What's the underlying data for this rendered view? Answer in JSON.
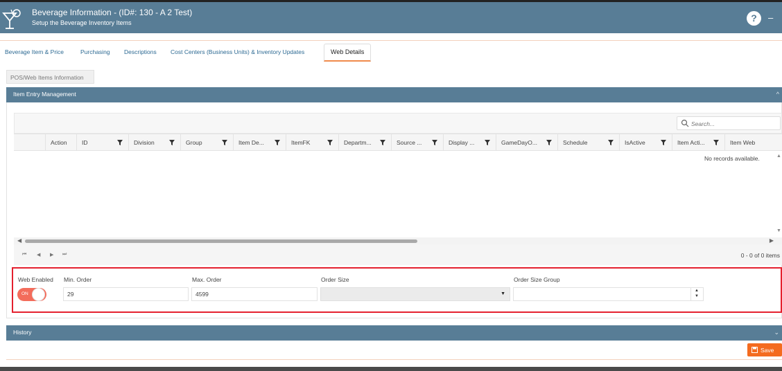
{
  "header": {
    "title": "Beverage Information - (ID#: 130 - A 2 Test)",
    "subtitle": "Setup the Beverage Inventory Items",
    "help_label": "?",
    "minimize_label": "–",
    "colors": {
      "header_bg": "#587d96",
      "accent": "#f46b1f"
    }
  },
  "tabs": [
    {
      "label": "Beverage Item & Price"
    },
    {
      "label": "Purchasing"
    },
    {
      "label": "Descriptions"
    },
    {
      "label": "Cost Centers (Business Units) & Inventory Updates"
    },
    {
      "label": "Web Details",
      "active": true
    }
  ],
  "subtab": {
    "label": "POS/Web Items Information"
  },
  "item_entry": {
    "title": "Item Entry Management",
    "search_placeholder": "Search...",
    "columns": [
      {
        "label": "Action",
        "filter": false
      },
      {
        "label": "ID",
        "filter": true
      },
      {
        "label": "Division",
        "filter": true
      },
      {
        "label": "Group",
        "filter": true
      },
      {
        "label": "Item De...",
        "filter": true
      },
      {
        "label": "ItemFK",
        "filter": true
      },
      {
        "label": "Departm...",
        "filter": true
      },
      {
        "label": "Source ...",
        "filter": true
      },
      {
        "label": "Display ...",
        "filter": true
      },
      {
        "label": "GameDayO...",
        "filter": true
      },
      {
        "label": "Schedule",
        "filter": true
      },
      {
        "label": "IsActive",
        "filter": true
      },
      {
        "label": "Item Acti...",
        "filter": true
      },
      {
        "label": "Item Web",
        "filter": false
      }
    ],
    "empty_message": "No records available.",
    "pager_info": "0 - 0 of 0 items"
  },
  "web_form": {
    "web_enabled_label": "Web Enabled",
    "toggle_text": "ON",
    "toggle_on": true,
    "min_order_label": "Min. Order",
    "min_order_value": "29",
    "max_order_label": "Max. Order",
    "max_order_value": "4599",
    "order_size_label": "Order Size",
    "order_size_value": "",
    "order_size_group_label": "Order Size Group",
    "order_size_group_value": ""
  },
  "history": {
    "title": "History"
  },
  "save_label": "Save"
}
